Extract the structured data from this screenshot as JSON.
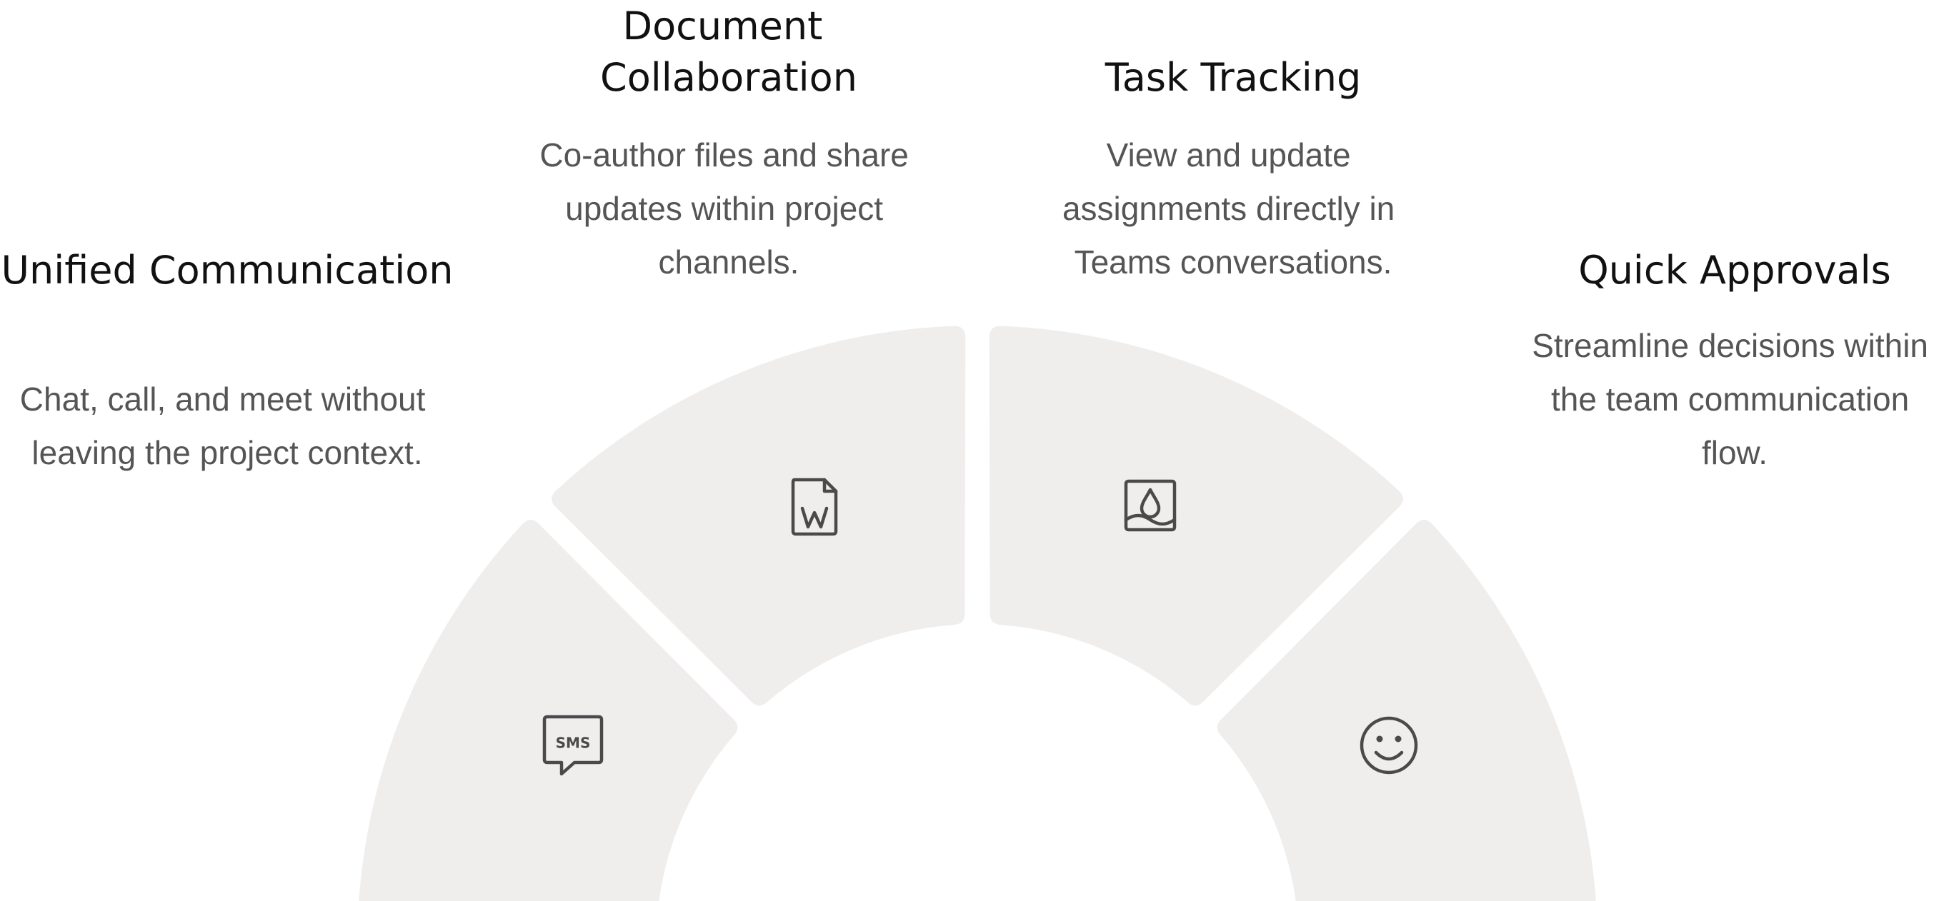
{
  "features": [
    {
      "id": "unified-communication",
      "title": [
        "Unified Communication"
      ],
      "description": [
        "Chat, call, and meet without",
        "leaving the project context."
      ],
      "icon": "sms-icon"
    },
    {
      "id": "document-collaboration",
      "title": [
        "Document",
        "Collaboration"
      ],
      "description": [
        "Co-author files and share",
        "updates within project",
        "channels."
      ],
      "icon": "word-document-icon"
    },
    {
      "id": "task-tracking",
      "title": [
        "Task Tracking"
      ],
      "description": [
        "View and update",
        "assignments directly in",
        "Teams conversations."
      ],
      "icon": "water-drop-icon"
    },
    {
      "id": "quick-approvals",
      "title": [
        "Quick Approvals"
      ],
      "description": [
        "Streamline decisions within",
        "the team communication",
        "flow."
      ],
      "icon": "smiley-icon"
    }
  ],
  "colors": {
    "segment": "#f0eded",
    "title": "#111111",
    "description": "#555555",
    "icon": "#4a4a4a"
  }
}
